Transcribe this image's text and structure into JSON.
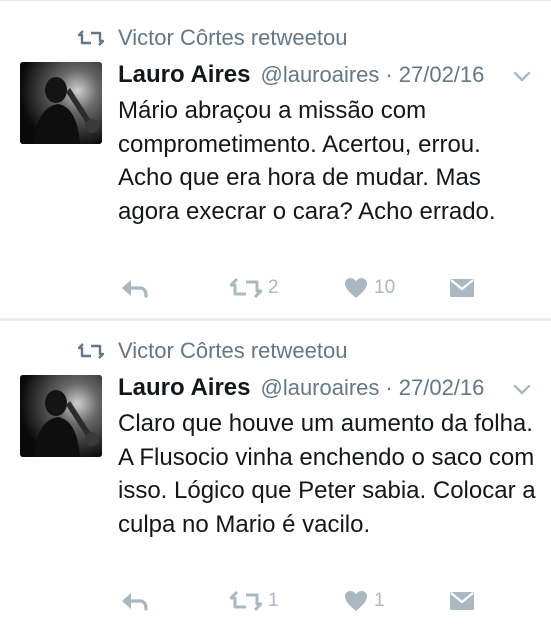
{
  "colors": {
    "text": "#14171a",
    "secondary": "#657786",
    "action_icons": "#aab8c2",
    "divider": "#e6ecf0"
  },
  "tweets": [
    {
      "retweet_label": "Victor Côrtes retweetou",
      "author_name": "Lauro Aires",
      "handle": "@lauroaires",
      "separator": "·",
      "date": "27/02/16",
      "text": "Mário abraçou a missão com comprometimento. Acertou, errou. Acho que era hora de mudar. Mas agora execrar o cara? Acho errado.",
      "retweet_count": "2",
      "like_count": "10",
      "icons": [
        "retweet-icon",
        "chevron-down-icon",
        "reply-icon",
        "retweet-icon",
        "heart-icon",
        "envelope-icon"
      ]
    },
    {
      "retweet_label": "Victor Côrtes retweetou",
      "author_name": "Lauro Aires",
      "handle": "@lauroaires",
      "separator": "·",
      "date": "27/02/16",
      "text": "Claro que houve um aumento da folha. A Flusocio vinha enchendo o saco com isso. Lógico que Peter sabia. Colocar a culpa no Mario é vacilo.",
      "retweet_count": "1",
      "like_count": "1",
      "icons": [
        "retweet-icon",
        "chevron-down-icon",
        "reply-icon",
        "retweet-icon",
        "heart-icon",
        "envelope-icon"
      ]
    }
  ]
}
